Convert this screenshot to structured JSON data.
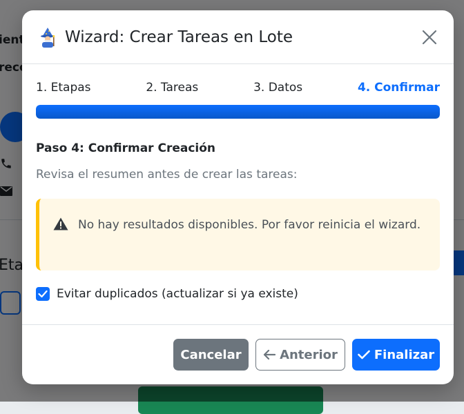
{
  "background": {
    "fragments": [
      "ient",
      "reco",
      "Eta"
    ]
  },
  "modal": {
    "title": "Wizard: Crear Tareas en Lote",
    "steps": [
      {
        "label": "1. Etapas",
        "active": false
      },
      {
        "label": "2. Tareas",
        "active": false
      },
      {
        "label": "3. Datos",
        "active": false
      },
      {
        "label": "4. Confirmar",
        "active": true
      }
    ],
    "progress_percent": 100,
    "step_heading": "Paso 4: Confirmar Creación",
    "step_description": "Revisa el resumen antes de crear las tareas:",
    "alert_text": "No hay resultados disponibles. Por favor reinicia el wizard.",
    "checkbox": {
      "label": "Evitar duplicados (actualizar si ya existe)",
      "checked": true
    },
    "footer": {
      "cancel_label": "Cancelar",
      "previous_label": "Anterior",
      "finish_label": "Finalizar"
    }
  },
  "colors": {
    "primary": "#0d6efd",
    "secondary": "#6c757d",
    "warning": "#ffc107"
  },
  "icons": [
    "wizard-icon",
    "close-icon",
    "warning-icon",
    "checkbox-check-icon",
    "arrow-left-icon",
    "check-icon"
  ]
}
